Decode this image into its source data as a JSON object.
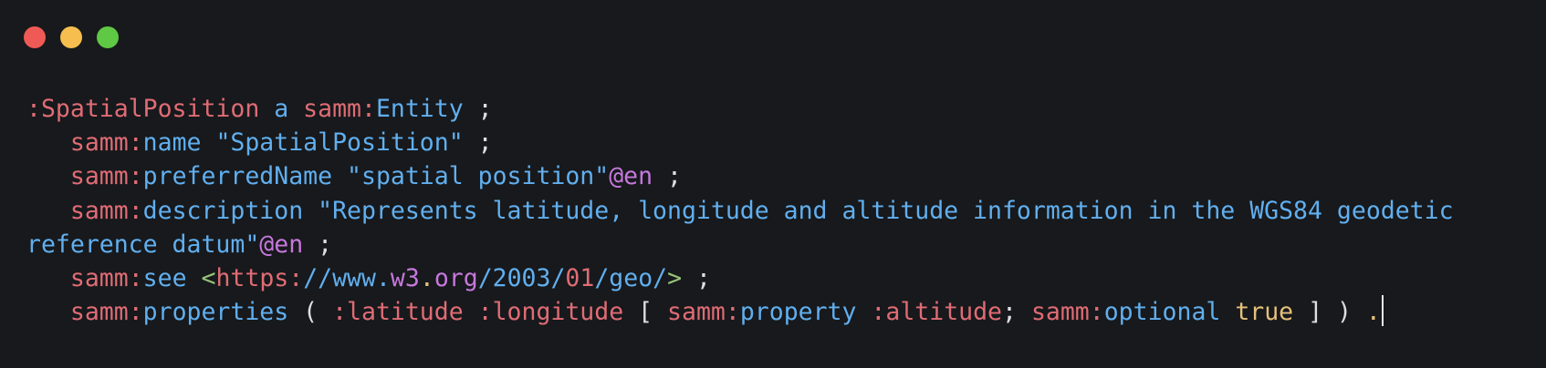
{
  "window": {
    "buttons": [
      {
        "name": "close-button",
        "color": "#f05a56"
      },
      {
        "name": "minimize-button",
        "color": "#f6be4f"
      },
      {
        "name": "zoom-button",
        "color": "#5fc845"
      }
    ]
  },
  "colors": {
    "keyword": "#e06c75",
    "ident": "#61afef",
    "string": "#61afef",
    "lang_tag": "#c678dd",
    "boolean": "#e5c07b",
    "punct": "#dcdfe4",
    "url_bracket": "#98c379"
  },
  "code": {
    "lines": [
      [
        {
          "t": ":SpatialPosition",
          "c": "keyword"
        },
        {
          "t": " a ",
          "c": "ident"
        },
        {
          "t": "samm:",
          "c": "keyword"
        },
        {
          "t": "Entity",
          "c": "ident"
        },
        {
          "t": " ;",
          "c": "punct"
        }
      ],
      [
        {
          "t": "   ",
          "c": "punct"
        },
        {
          "t": "samm:",
          "c": "keyword"
        },
        {
          "t": "name",
          "c": "ident"
        },
        {
          "t": " \"SpatialPosition\"",
          "c": "string"
        },
        {
          "t": " ;",
          "c": "punct"
        }
      ],
      [
        {
          "t": "   ",
          "c": "punct"
        },
        {
          "t": "samm:",
          "c": "keyword"
        },
        {
          "t": "preferredName",
          "c": "ident"
        },
        {
          "t": " \"spatial position\"",
          "c": "string"
        },
        {
          "t": "@en",
          "c": "lang_tag"
        },
        {
          "t": " ;",
          "c": "punct"
        }
      ],
      [
        {
          "t": "   ",
          "c": "punct"
        },
        {
          "t": "samm:",
          "c": "keyword"
        },
        {
          "t": "description",
          "c": "ident"
        },
        {
          "t": " \"Represents latitude, longitude and altitude information in the WGS84 geodetic",
          "c": "string"
        }
      ],
      [
        {
          "t": "reference datum\"",
          "c": "string"
        },
        {
          "t": "@en",
          "c": "lang_tag"
        },
        {
          "t": " ;",
          "c": "punct"
        }
      ],
      [
        {
          "t": "   ",
          "c": "punct"
        },
        {
          "t": "samm:",
          "c": "keyword"
        },
        {
          "t": "see ",
          "c": "ident"
        },
        {
          "t": "<",
          "c": "url_bracket"
        },
        {
          "t": "https:",
          "c": "keyword"
        },
        {
          "t": "//www.",
          "c": "ident"
        },
        {
          "t": "w3",
          "c": "lang_tag"
        },
        {
          "t": ".",
          "c": "boolean"
        },
        {
          "t": "org",
          "c": "lang_tag"
        },
        {
          "t": "/2003/",
          "c": "ident"
        },
        {
          "t": "01",
          "c": "keyword"
        },
        {
          "t": "/geo/",
          "c": "ident"
        },
        {
          "t": ">",
          "c": "url_bracket"
        },
        {
          "t": " ;",
          "c": "punct"
        }
      ],
      [
        {
          "t": "   ",
          "c": "punct"
        },
        {
          "t": "samm:",
          "c": "keyword"
        },
        {
          "t": "properties",
          "c": "ident"
        },
        {
          "t": " ( ",
          "c": "punct"
        },
        {
          "t": ":latitude :longitude",
          "c": "keyword"
        },
        {
          "t": " [ ",
          "c": "punct"
        },
        {
          "t": "samm:",
          "c": "keyword"
        },
        {
          "t": "property",
          "c": "ident"
        },
        {
          "t": " :altitude",
          "c": "keyword"
        },
        {
          "t": "; ",
          "c": "punct"
        },
        {
          "t": "samm:",
          "c": "keyword"
        },
        {
          "t": "optional",
          "c": "ident"
        },
        {
          "t": " true",
          "c": "boolean"
        },
        {
          "t": " ] ) ",
          "c": "punct"
        },
        {
          "t": ".",
          "c": "boolean"
        }
      ]
    ]
  }
}
